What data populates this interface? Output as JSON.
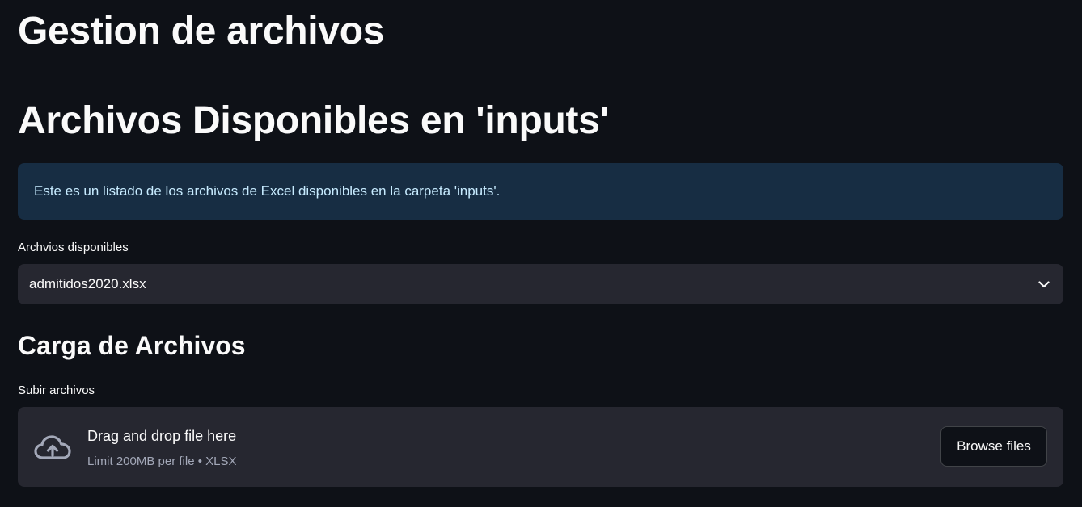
{
  "page": {
    "title": "Gestion de archivos"
  },
  "inputs_section": {
    "title": "Archivos Disponibles en 'inputs'",
    "info_text": "Este es un listado de los archivos de Excel disponibles en la carpeta 'inputs'.",
    "select_label": "Archvios disponibles",
    "selected_value": "admitidos2020.xlsx"
  },
  "upload_section": {
    "title": "Carga de Archivos",
    "uploader_label": "Subir archivos",
    "drop_text": "Drag and drop file here",
    "limit_text": "Limit 200MB per file • XLSX",
    "browse_label": "Browse files"
  },
  "icons": {
    "chevron": "chevron-down-icon",
    "upload": "cloud-upload-icon"
  },
  "colors": {
    "background": "#0e1117",
    "info_background": "#172d43",
    "info_text": "#c7ebff",
    "widget_background": "#262730",
    "secondary_text": "#a3a8b8"
  }
}
